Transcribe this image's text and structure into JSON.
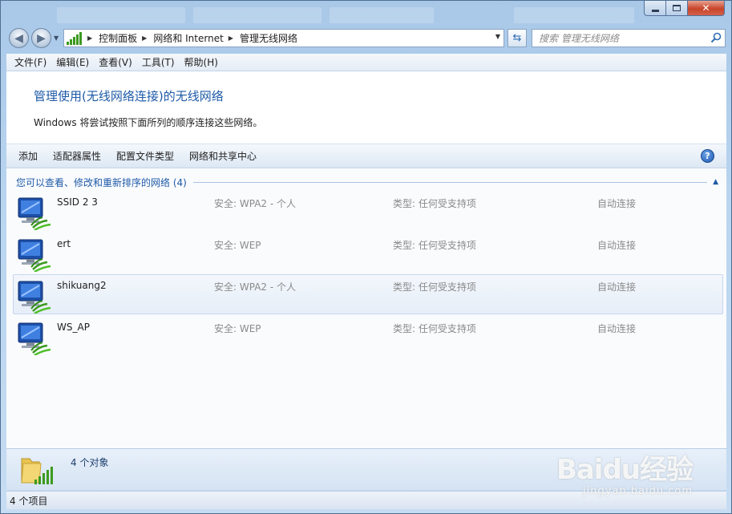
{
  "navbar": {
    "breadcrumbs": [
      "控制面板",
      "网络和 Internet",
      "管理无线网络"
    ],
    "search_placeholder": "搜索 管理无线网络"
  },
  "menubar": {
    "items": [
      "文件(F)",
      "编辑(E)",
      "查看(V)",
      "工具(T)",
      "帮助(H)"
    ]
  },
  "page": {
    "title": "管理使用(无线网络连接)的无线网络",
    "description": "Windows 将尝试按照下面所列的顺序连接这些网络。"
  },
  "commands": [
    "添加",
    "适配器属性",
    "配置文件类型",
    "网络和共享中心"
  ],
  "group": {
    "label": "您可以查看、修改和重新排序的网络 (4)"
  },
  "networks": [
    {
      "name": "SSID 2 3",
      "security": "安全: WPA2 - 个人",
      "type": "类型: 任何受支持项",
      "mode": "自动连接"
    },
    {
      "name": "ert",
      "security": "安全: WEP",
      "type": "类型: 任何受支持项",
      "mode": "自动连接"
    },
    {
      "name": "shikuang2",
      "security": "安全: WPA2 - 个人",
      "type": "类型: 任何受支持项",
      "mode": "自动连接"
    },
    {
      "name": "WS_AP",
      "security": "安全: WEP",
      "type": "类型: 任何受支持项",
      "mode": "自动连接"
    }
  ],
  "details": {
    "count": "4 个对象"
  },
  "status": {
    "items": "4 个项目"
  },
  "watermark": {
    "logo": "Baidu经验",
    "url": "jingyan.baidu.com"
  },
  "colors": {
    "accent": "#1e5aa8",
    "selection": "#e6eef8",
    "signal": "#3b9a1f"
  }
}
